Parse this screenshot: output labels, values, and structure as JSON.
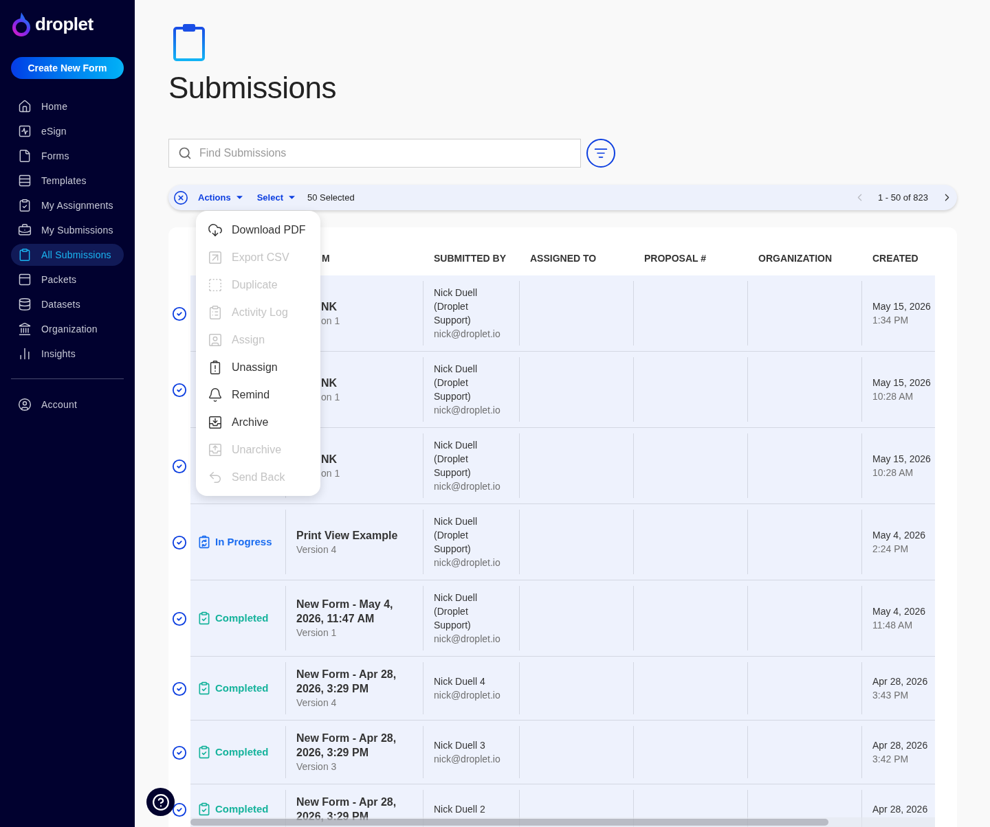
{
  "sidebar": {
    "logo": "droplet",
    "create_button": "Create New Form",
    "items": [
      {
        "label": "Home",
        "selected": false
      },
      {
        "label": "eSign",
        "selected": false
      },
      {
        "label": "Forms",
        "selected": false
      },
      {
        "label": "Templates",
        "selected": false
      },
      {
        "label": "My Assignments",
        "selected": false
      },
      {
        "label": "My Submissions",
        "selected": false
      },
      {
        "label": "All Submissions",
        "selected": true
      },
      {
        "label": "Packets",
        "selected": false
      },
      {
        "label": "Datasets",
        "selected": false
      },
      {
        "label": "Organization",
        "selected": false
      },
      {
        "label": "Insights",
        "selected": false
      }
    ],
    "account": {
      "label": "Account",
      "selected": false
    }
  },
  "page": {
    "title": "Submissions"
  },
  "search": {
    "placeholder": "Find Submissions"
  },
  "toolbar": {
    "actions": "Actions",
    "select": "Select",
    "selection": "50 Selected",
    "pagination": {
      "label": "1 - 50 of 823",
      "previous": {
        "disabled": true
      },
      "next": {
        "disabled": false
      }
    }
  },
  "actions_menu": {
    "expanded": true,
    "items": [
      {
        "label": "Download PDF",
        "disabled": false
      },
      {
        "label": "Export CSV",
        "disabled": true
      },
      {
        "label": "Duplicate",
        "disabled": true
      },
      {
        "label": "Activity Log",
        "disabled": true
      },
      {
        "label": "Assign",
        "disabled": true
      },
      {
        "label": "Unassign",
        "disabled": false
      },
      {
        "label": "Remind",
        "disabled": false
      },
      {
        "label": "Archive",
        "disabled": false
      },
      {
        "label": "Unarchive",
        "disabled": true
      },
      {
        "label": "Send Back",
        "disabled": true
      }
    ]
  },
  "table": {
    "columns": [
      "M",
      "SUBMITTED BY",
      "ASSIGNED TO",
      "PROPOSAL #",
      "ORGANIZATION",
      "CREATED"
    ],
    "rows": [
      {
        "selected": true,
        "form": {
          "name": "NK",
          "version": "on 1"
        },
        "submitted_by": {
          "name": "Nick Duell (Droplet Support)",
          "email": "nick@droplet.io"
        },
        "created": {
          "date": "May 15, 2026",
          "time": "1:34 PM"
        }
      },
      {
        "selected": true,
        "form": {
          "name": "NK",
          "version": "on 1"
        },
        "submitted_by": {
          "name": "Nick Duell (Droplet Support)",
          "email": "nick@droplet.io"
        },
        "created": {
          "date": "May 15, 2026",
          "time": "10:28 AM"
        }
      },
      {
        "selected": true,
        "form": {
          "name": "NK",
          "version": "on 1"
        },
        "submitted_by": {
          "name": "Nick Duell (Droplet Support)",
          "email": "nick@droplet.io"
        },
        "created": {
          "date": "May 15, 2026",
          "time": "10:28 AM"
        }
      },
      {
        "selected": true,
        "status": {
          "kind": "in_progress",
          "label": "In Progress"
        },
        "form": {
          "name": "Print View Example",
          "version": "Version 4"
        },
        "submitted_by": {
          "name": "Nick Duell (Droplet Support)",
          "email": "nick@droplet.io"
        },
        "created": {
          "date": "May 4, 2026",
          "time": "2:24 PM"
        }
      },
      {
        "selected": true,
        "status": {
          "kind": "completed",
          "label": "Completed"
        },
        "form": {
          "name": "New Form - May 4, 2026, 11:47 AM",
          "version": "Version 1"
        },
        "submitted_by": {
          "name": "Nick Duell (Droplet Support)",
          "email": "nick@droplet.io"
        },
        "created": {
          "date": "May 4, 2026",
          "time": "11:48 AM"
        }
      },
      {
        "selected": true,
        "status": {
          "kind": "completed",
          "label": "Completed"
        },
        "form": {
          "name": "New Form - Apr 28, 2026, 3:29 PM",
          "version": "Version 4"
        },
        "submitted_by": {
          "name": "Nick Duell 4",
          "email": "nick@droplet.io"
        },
        "created": {
          "date": "Apr 28, 2026",
          "time": "3:43 PM"
        }
      },
      {
        "selected": true,
        "status": {
          "kind": "completed",
          "label": "Completed"
        },
        "form": {
          "name": "New Form - Apr 28, 2026, 3:29 PM",
          "version": "Version 3"
        },
        "submitted_by": {
          "name": "Nick Duell 3",
          "email": "nick@droplet.io"
        },
        "created": {
          "date": "Apr 28, 2026",
          "time": "3:42 PM"
        }
      },
      {
        "selected": true,
        "status": {
          "kind": "completed",
          "label": "Completed"
        },
        "form": {
          "name": "New Form - Apr 28, 2026, 3:29 PM"
        },
        "submitted_by": {
          "name": "Nick Duell 2"
        },
        "created": {
          "date": "Apr 28, 2026"
        }
      }
    ]
  }
}
